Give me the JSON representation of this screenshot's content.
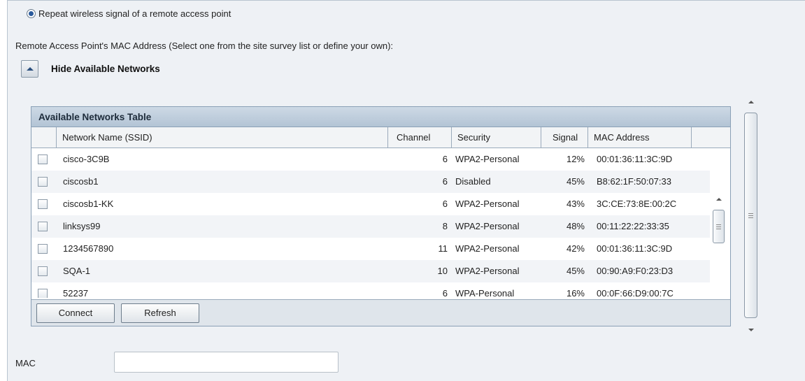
{
  "mode": {
    "label": "Repeat wireless signal of a remote access point",
    "selected": true
  },
  "mac_caption": "Remote Access Point's MAC Address (Select one from the site survey list or define your own):",
  "toggle": {
    "label": "Hide Available Networks",
    "icon": "collapse-up-icon"
  },
  "table": {
    "title": "Available Networks Table",
    "columns": {
      "ssid": "Network Name (SSID)",
      "channel": "Channel",
      "security": "Security",
      "signal": "Signal",
      "mac": "MAC Address"
    },
    "rows": [
      {
        "ssid": "cisco-3C9B",
        "channel": "6",
        "security": "WPA2-Personal",
        "signal": "12%",
        "mac": "00:01:36:11:3C:9D",
        "checked": false
      },
      {
        "ssid": "ciscosb1",
        "channel": "6",
        "security": "Disabled",
        "signal": "45%",
        "mac": "B8:62:1F:50:07:33",
        "checked": false
      },
      {
        "ssid": "ciscosb1-KK",
        "channel": "6",
        "security": "WPA2-Personal",
        "signal": "43%",
        "mac": "3C:CE:73:8E:00:2C",
        "checked": false
      },
      {
        "ssid": "linksys99",
        "channel": "8",
        "security": "WPA2-Personal",
        "signal": "48%",
        "mac": "00:11:22:22:33:35",
        "checked": false
      },
      {
        "ssid": "1234567890",
        "channel": "11",
        "security": "WPA2-Personal",
        "signal": "42%",
        "mac": "00:01:36:11:3C:9D",
        "checked": false
      },
      {
        "ssid": "SQA-1",
        "channel": "10",
        "security": "WPA2-Personal",
        "signal": "45%",
        "mac": "00:90:A9:F0:23:D3",
        "checked": false
      },
      {
        "ssid": "52237",
        "channel": "6",
        "security": "WPA-Personal",
        "signal": "16%",
        "mac": "00:0F:66:D9:00:7C",
        "checked": false
      }
    ],
    "buttons": {
      "connect": "Connect",
      "refresh": "Refresh"
    }
  },
  "mac_field": {
    "label": "MAC",
    "value": "",
    "placeholder": ""
  },
  "colors": {
    "panel_bg": "#eef1f5",
    "table_header": "#b3c4d5",
    "accent": "#2a5a9c"
  }
}
